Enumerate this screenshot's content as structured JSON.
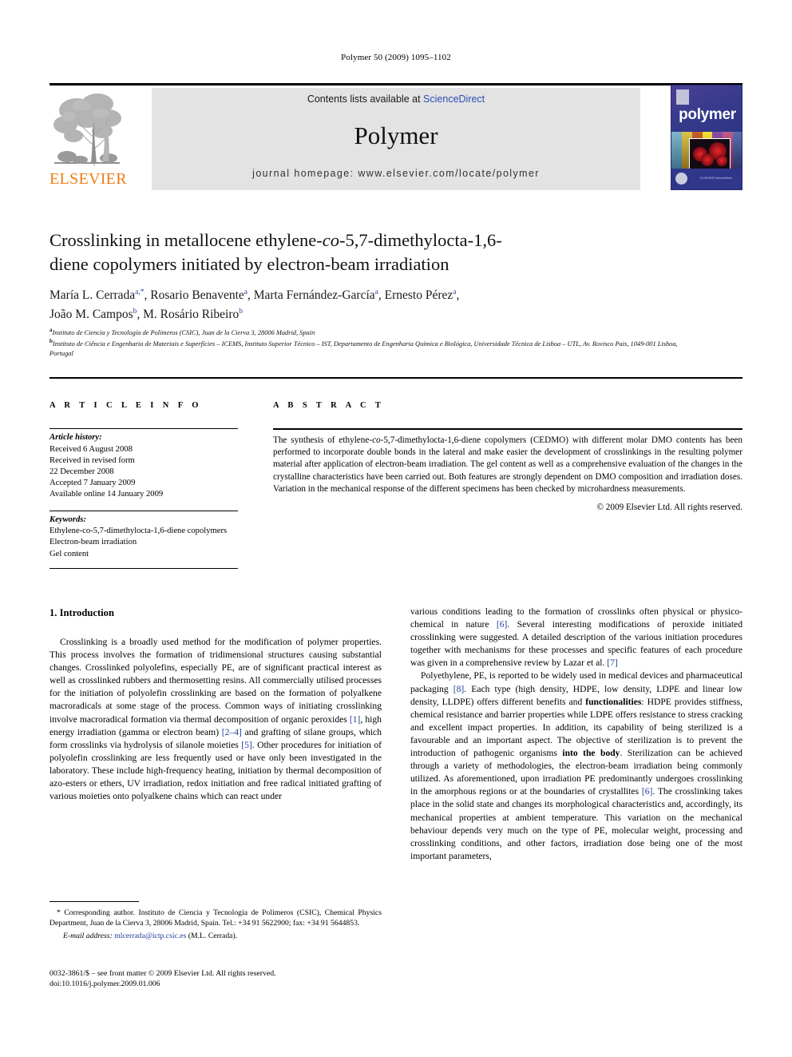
{
  "running_head": "Polymer 50 (2009) 1095–1102",
  "masthead": {
    "publisher_name": "ELSEVIER",
    "contents_prefix": "Contents lists available at ",
    "contents_link": "ScienceDirect",
    "journal_title": "Polymer",
    "homepage_line": "journal homepage: www.elsevier.com/locate/polymer",
    "cover_word": "polymer",
    "cover_footer": "ELSEVIER ScienceDirect",
    "accent_orange": "#ef7c16",
    "link_blue": "#2b4bb5",
    "band_grey": "#e3e3e3",
    "cover_blue": "#3a3f8f"
  },
  "article": {
    "title": "Crosslinking in metallocene ethylene-co-5,7-dimethylocta-1,6-diene copolymers initiated by electron-beam irradiation",
    "authors_line_1": "María L. Cerrada",
    "authors": [
      {
        "name": "María L. Cerrada",
        "sup": "a,*"
      },
      {
        "name": "Rosario Benavente",
        "sup": "a"
      },
      {
        "name": "Marta Fernández-García",
        "sup": "a"
      },
      {
        "name": "Ernesto Pérez",
        "sup": "a"
      },
      {
        "name": "João M. Campos",
        "sup": "b"
      },
      {
        "name": "M. Rosário Ribeiro",
        "sup": "b"
      }
    ],
    "affiliations": [
      {
        "sup": "a",
        "text": "Instituto de Ciencia y Tecnología de Polímeros (CSIC), Juan de la Cierva 3, 28006 Madrid, Spain"
      },
      {
        "sup": "b",
        "text": "Instituto de Ciência e Engenharia de Materiais e Superfícies – ICEMS, Instituto Superior Técnico – IST, Departamento de Engenharia Química e Biológica, Universidade Técnica de Lisboa – UTL, Av. Rovisco Pais, 1049-001 Lisboa, Portugal"
      }
    ]
  },
  "article_info": {
    "heading": "A R T I C L E   I N F O",
    "history_label": "Article history:",
    "history": [
      "Received 6 August 2008",
      "Received in revised form",
      "22 December 2008",
      "Accepted 7 January 2009",
      "Available online 14 January 2009"
    ],
    "keywords_label": "Keywords:",
    "keywords": [
      "Ethylene-co-5,7-dimethylocta-1,6-diene copolymers",
      "Electron-beam irradiation",
      "Gel content"
    ]
  },
  "abstract": {
    "heading": "A B S T R A C T",
    "text_part_1": "The synthesis of ethylene-",
    "text_italic": "co",
    "text_part_2": "-5,7-dimethylocta-1,6-diene copolymers (CEDMO) with different molar DMO contents has been performed to incorporate double bonds in the lateral and make easier the development of crosslinkings in the resulting polymer material after application of electron-beam irradiation. The gel content as well as a comprehensive evaluation of the changes in the crystalline characteristics have been carried out. Both features are strongly dependent on DMO composition and irradiation doses. Variation in the mechanical response of the different specimens has been checked by microhardness measurements.",
    "copyright": "© 2009 Elsevier Ltd. All rights reserved."
  },
  "body": {
    "section_heading": "1. Introduction",
    "left_p1_a": "Crosslinking is a broadly used method for the modification of polymer properties. This process involves the formation of tridimensional structures causing substantial changes. Crosslinked polyolefins, especially PE, are of significant practical interest as well as crosslinked rubbers and thermosetting resins. All commercially utilised processes for the initiation of polyolefin crosslinking are based on the formation of polyalkene macroradicals at some stage of the process. Common ways of initiating crosslinking involve macroradical formation via thermal decomposition of organic peroxides ",
    "ref_1": "[1]",
    "left_p1_b": ", high energy irradiation (gamma or electron beam) ",
    "ref_2_4": "[2–4]",
    "left_p1_c": " and grafting of silane groups, which form crosslinks via hydrolysis of silanole moieties ",
    "ref_5": "[5]",
    "left_p1_d": ". Other procedures for initiation of polyolefin crosslinking are less frequently used or have only been investigated in the laboratory. These include high-frequency heating, initiation by thermal decomposition of azo-esters or ethers, UV irradiation, redox initiation and free radical initiated grafting of various moieties onto polyalkene chains which can react under",
    "right_p1_a": "various conditions leading to the formation of crosslinks often physical or physico-chemical in nature ",
    "ref_6": "[6]",
    "right_p1_b": ". Several interesting modifications of peroxide initiated crosslinking were suggested. A detailed description of the various initiation procedures together with mechanisms for these processes and specific features of each procedure was given in a comprehensive review by Lazar et al. ",
    "ref_7": "[7]",
    "right_p2_a": "Polyethylene, PE, is reported to be widely used in medical devices and pharmaceutical packaging ",
    "ref_8": "[8]",
    "right_p2_b": ". Each type (high density, HDPE, low density, LDPE and linear low density, LLDPE) offers different benefits and ",
    "bold_1": "functionalities",
    "right_p2_c": ": HDPE provides stiffness, chemical resistance and barrier properties while LDPE offers resistance to stress cracking and excellent impact properties. In addition, its capability of being sterilized is a favourable and an important aspect. The objective of sterilization is to prevent the introduction of pathogenic organisms ",
    "bold_2": "into the body",
    "right_p2_d": ". Sterilization can be achieved through a variety of methodologies, the electron-beam irradiation being commonly utilized. As aforementioned, upon irradiation PE predominantly undergoes crosslinking in the amorphous regions or at the boundaries of crystallites ",
    "ref_6b": "[6]",
    "right_p2_e": ". The crosslinking takes place in the solid state and changes its morphological characteristics and, accordingly, its mechanical properties at ambient temperature. This variation on the mechanical behaviour depends very much on the type of PE, molecular weight, processing and crosslinking conditions, and other factors, irradiation dose being one of the most important parameters,"
  },
  "footnote": {
    "star_text": "* Corresponding author. Instituto de Ciencia y Tecnología de Polímeros (CSIC), Chemical Physics Department, Juan de la Cierva 3, 28006 Madrid, Spain. Tel.: +34 91 5622900; fax: +34 91 5644853.",
    "email_label": "E-mail address:",
    "email": "mlcerrada@ictp.csic.es",
    "email_suffix": "(M.L. Cerrada)."
  },
  "colophon": {
    "line_1": "0032-3861/$ – see front matter © 2009 Elsevier Ltd. All rights reserved.",
    "line_2": "doi:10.1016/j.polymer.2009.01.006"
  }
}
